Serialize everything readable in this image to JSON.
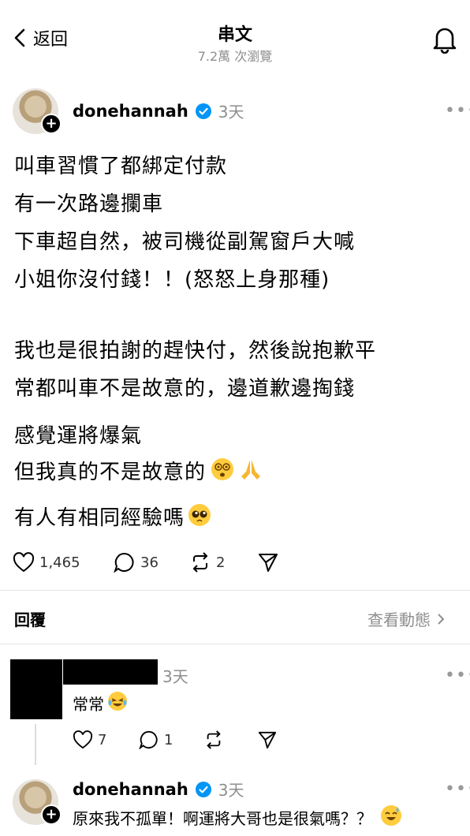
{
  "header": {
    "back_label": "返回",
    "title": "串文",
    "subtitle": "7.2萬 次瀏覽"
  },
  "post": {
    "username": "donehannah",
    "time": "3天",
    "lines": [
      "叫車習慣了都綁定付款",
      "有一次路邊攔車",
      "下車超自然，被司機從副駕窗戶大喊",
      "小姐你沒付錢！！(怒怒上身那種)",
      "我也是很拍謝的趕快付，然後說抱歉平",
      "常都叫車不是故意的，邊道歉邊掏錢",
      "感覺運將爆氣",
      "但我真的不是故意的",
      "有人有相同經驗嗎"
    ],
    "likes": "1,465",
    "comments": "36",
    "reposts": "2"
  },
  "replies_section": {
    "label": "回覆",
    "activity_link": "查看動態"
  },
  "reply1": {
    "time": "3天",
    "text": "常常",
    "likes": "7",
    "comments": "1"
  },
  "reply2": {
    "username": "donehannah",
    "time": "3天",
    "text": "原來我不孤單！啊運將大哥也是很氣嗎？？"
  },
  "colors": {
    "verified": "#0095f6",
    "muted": "#8e8e8e",
    "redacted": "#000000"
  },
  "icons": [
    "chevron-left-icon",
    "bell-icon",
    "verified-icon",
    "more-icon",
    "heart-icon",
    "comment-icon",
    "repost-icon",
    "share-icon",
    "chevron-right-icon",
    "dizzy-face-emoji",
    "praying-hands-emoji",
    "pleading-face-emoji",
    "laughing-tears-emoji",
    "sweat-smile-emoji"
  ]
}
